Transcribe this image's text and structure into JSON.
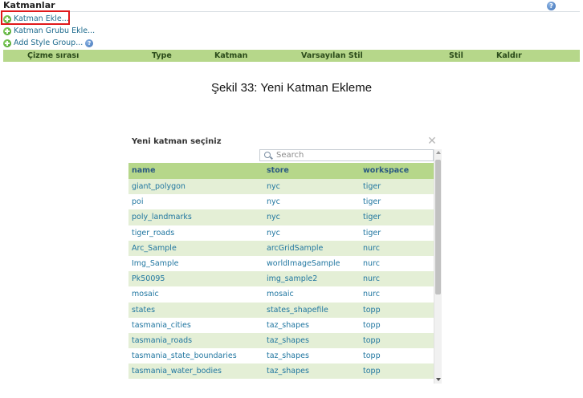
{
  "panel": {
    "title": "Katmanlar",
    "help": "?",
    "actions": [
      {
        "label": "Katman Ekle..."
      },
      {
        "label": "Katman Grubu Ekle..."
      },
      {
        "label": "Add Style Group..."
      }
    ],
    "columns": [
      "Çizme sırası",
      "Type",
      "Katman",
      "Varsayılan Stil",
      "Stil",
      "Kaldır"
    ]
  },
  "caption": "Şekil 33: Yeni Katman Ekleme",
  "dialog": {
    "title": "Yeni katman seçiniz",
    "close": "✕",
    "search_placeholder": "Search",
    "headers": [
      "name",
      "store",
      "workspace"
    ],
    "rows": [
      [
        "giant_polygon",
        "nyc",
        "tiger"
      ],
      [
        "poi",
        "nyc",
        "tiger"
      ],
      [
        "poly_landmarks",
        "nyc",
        "tiger"
      ],
      [
        "tiger_roads",
        "nyc",
        "tiger"
      ],
      [
        "Arc_Sample",
        "arcGridSample",
        "nurc"
      ],
      [
        "Img_Sample",
        "worldImageSample",
        "nurc"
      ],
      [
        "Pk50095",
        "img_sample2",
        "nurc"
      ],
      [
        "mosaic",
        "mosaic",
        "nurc"
      ],
      [
        "states",
        "states_shapefile",
        "topp"
      ],
      [
        "tasmania_cities",
        "taz_shapes",
        "topp"
      ],
      [
        "tasmania_roads",
        "taz_shapes",
        "topp"
      ],
      [
        "tasmania_state_boundaries",
        "taz_shapes",
        "topp"
      ],
      [
        "tasmania_water_bodies",
        "taz_shapes",
        "topp"
      ]
    ]
  },
  "colors": {
    "header_green": "#b6d78a",
    "row_alt": "#e4efd6",
    "link_blue": "#2076a0",
    "highlight_red": "#e0191b"
  }
}
